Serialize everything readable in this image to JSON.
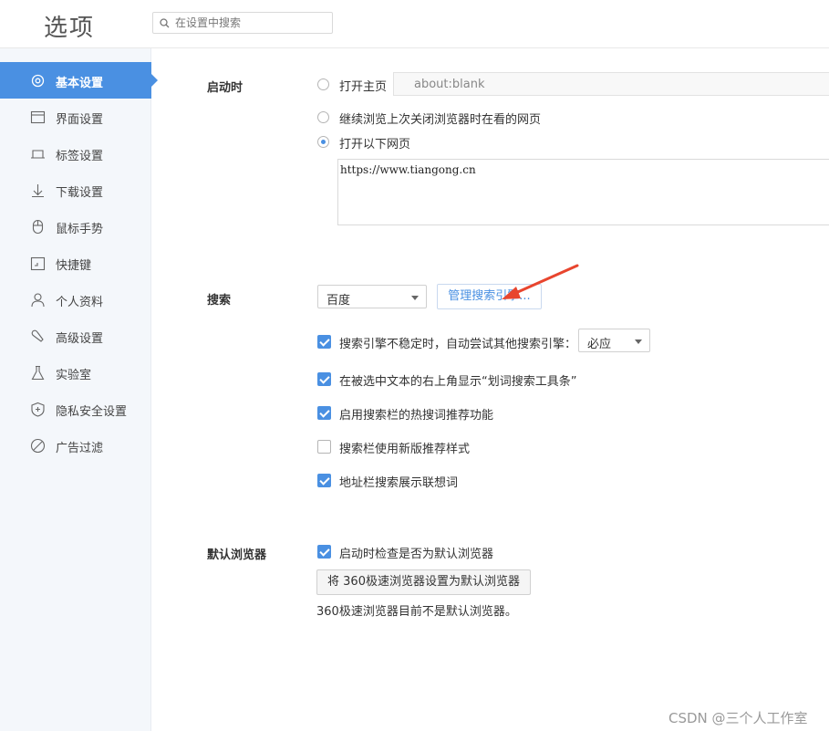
{
  "header": {
    "title": "选项",
    "search_placeholder": "在设置中搜索"
  },
  "sidebar": {
    "items": [
      {
        "label": "基本设置",
        "icon": "settings-icon",
        "active": true
      },
      {
        "label": "界面设置",
        "icon": "window-icon"
      },
      {
        "label": "标签设置",
        "icon": "tab-icon"
      },
      {
        "label": "下载设置",
        "icon": "download-icon"
      },
      {
        "label": "鼠标手势",
        "icon": "mouse-icon"
      },
      {
        "label": "快捷键",
        "icon": "shortcut-icon"
      },
      {
        "label": "个人资料",
        "icon": "user-icon"
      },
      {
        "label": "高级设置",
        "icon": "wrench-icon"
      },
      {
        "label": "实验室",
        "icon": "flask-icon"
      },
      {
        "label": "隐私安全设置",
        "icon": "shield-icon"
      },
      {
        "label": "广告过滤",
        "icon": "block-icon"
      }
    ]
  },
  "startup": {
    "label": "启动时",
    "open_homepage": "打开主页",
    "homepage_value": "about:blank",
    "continue_last": "继续浏览上次关闭浏览器时在看的网页",
    "open_pages": "打开以下网页",
    "pages_value": "https://www.tiangong.cn",
    "selected": "open_pages"
  },
  "search": {
    "label": "搜索",
    "engine_value": "百度",
    "manage_button": "管理搜索引擎...",
    "options": [
      {
        "label": "搜索引擎不稳定时，自动尝试其他搜索引擎：",
        "checked": true
      },
      {
        "label": "在被选中文本的右上角显示“划词搜索工具条”",
        "checked": true
      },
      {
        "label": "启用搜索栏的热搜词推荐功能",
        "checked": true
      },
      {
        "label": "搜索栏使用新版推荐样式",
        "checked": false
      },
      {
        "label": "地址栏搜索展示联想词",
        "checked": true
      }
    ],
    "fallback_value": "必应"
  },
  "default_browser": {
    "label": "默认浏览器",
    "check_label": "启动时检查是否为默认浏览器",
    "checked": true,
    "set_button": "将 360极速浏览器设置为默认浏览器",
    "status": "360极速浏览器目前不是默认浏览器。"
  },
  "watermark": "CSDN @三个人工作室",
  "colors": {
    "accent": "#4a90e2",
    "annotation_arrow": "#e8452e"
  }
}
